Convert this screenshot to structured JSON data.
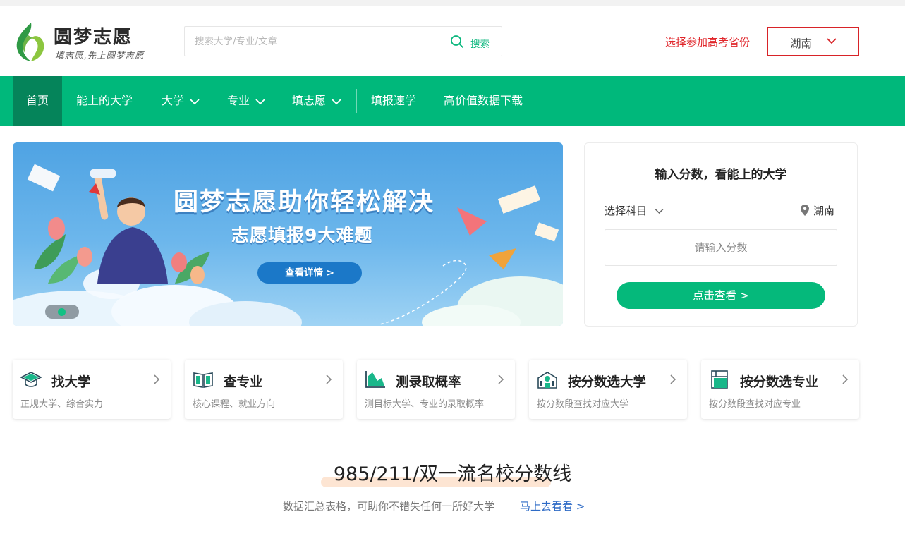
{
  "brand": {
    "name": "圆梦志愿",
    "slogan": "填志愿,先上圆梦志愿",
    "accent_color": "#00b87b",
    "nav_active_color": "#05845a",
    "province_color": "#e0262b"
  },
  "search": {
    "placeholder": "搜索大学/专业/文章",
    "button_label": "搜索",
    "icon": "search-icon"
  },
  "province": {
    "label": "选择参加高考省份",
    "selected": "湖南",
    "icon": "chevron-down-icon"
  },
  "nav": {
    "items": [
      {
        "label": "首页",
        "active": true
      },
      {
        "label": "能上的大学"
      },
      {
        "label": "大学",
        "dropdown": true
      },
      {
        "label": "专业",
        "dropdown": true
      },
      {
        "label": "填志愿",
        "dropdown": true
      },
      {
        "label": "填报速学"
      },
      {
        "label": "高价值数据下载"
      }
    ]
  },
  "banner": {
    "title": "圆梦志愿助你轻松解决",
    "subtitle": "志愿填报9大难题",
    "button_label": "查看详情 >"
  },
  "score_panel": {
    "title": "输入分数，看能上的大学",
    "subject_label": "选择科目",
    "location": "湖南",
    "input_placeholder": "请输入分数",
    "button_label": "点击查看 >"
  },
  "features": [
    {
      "title": "找大学",
      "desc": "正规大学、综合实力",
      "icon": "graduation-cap-icon"
    },
    {
      "title": "查专业",
      "desc": "核心课程、就业方向",
      "icon": "open-book-icon"
    },
    {
      "title": "测录取概率",
      "desc": "测目标大学、专业的录取概率",
      "icon": "area-chart-icon"
    },
    {
      "title": "按分数选大学",
      "desc": "按分数段查找对应大学",
      "icon": "school-building-icon"
    },
    {
      "title": "按分数选专业",
      "desc": "按分数段查找对应专业",
      "icon": "book-icon"
    }
  ],
  "section": {
    "title": "985/211/双一流名校分数线",
    "desc": "数据汇总表格，可助你不错失任何一所好大学",
    "link": "马上去看看 >"
  }
}
